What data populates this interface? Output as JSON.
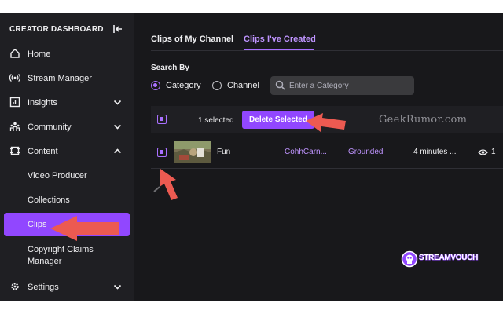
{
  "sidebar": {
    "title": "CREATOR DASHBOARD",
    "items": [
      {
        "label": "Home",
        "icon": "home-icon"
      },
      {
        "label": "Stream Manager",
        "icon": "broadcast-icon"
      },
      {
        "label": "Insights",
        "icon": "chart-icon",
        "expandable": true
      },
      {
        "label": "Community",
        "icon": "community-icon",
        "expandable": true
      },
      {
        "label": "Content",
        "icon": "content-icon",
        "expanded": true
      }
    ],
    "sub_items": [
      {
        "label": "Video Producer"
      },
      {
        "label": "Collections"
      },
      {
        "label": "Clips",
        "active": true
      },
      {
        "label": "Copyright Claims Manager"
      }
    ],
    "settings": {
      "label": "Settings",
      "icon": "gear-icon"
    }
  },
  "main": {
    "tabs": [
      {
        "label": "Clips of My Channel",
        "active": false
      },
      {
        "label": "Clips I've Created",
        "active": true
      }
    ],
    "search_by": {
      "label": "Search By",
      "options": [
        "Category",
        "Channel"
      ],
      "selected": "Category",
      "placeholder": "Enter a Category"
    },
    "selection": {
      "count_text": "1 selected",
      "delete_label": "Delete Selected"
    },
    "clip_row": {
      "title": "Fun",
      "channel": "CohhCarn...",
      "category": "Grounded",
      "time": "4 minutes ...",
      "views": "1"
    }
  },
  "watermark": "GeekRumor.com",
  "logo_text": "STREAMVOUCH",
  "colors": {
    "accent": "#9147ff",
    "accent_light": "#a970ff",
    "annotation_arrow": "#ec5a51",
    "background": "#0e0e10",
    "sidebar": "#1f1f23"
  }
}
